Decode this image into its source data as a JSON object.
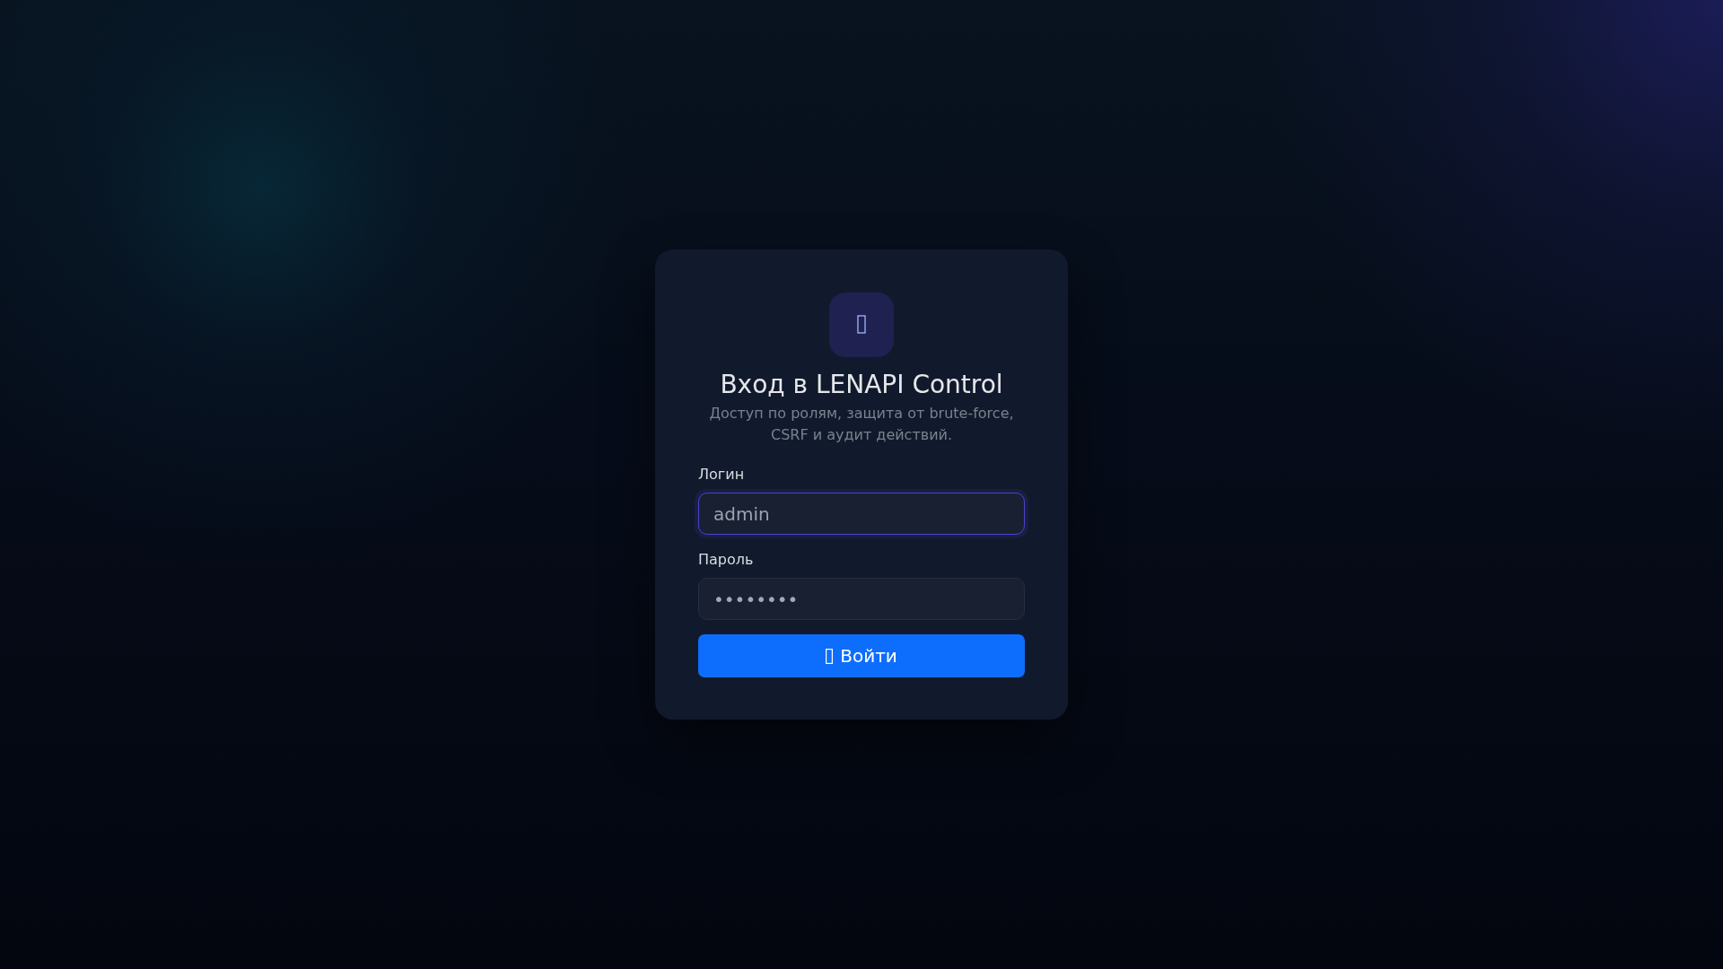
{
  "card": {
    "title": "Вход в LENAPI Control",
    "subtitle": "Доступ по ролям, защита от brute-force, CSRF и аудит действий."
  },
  "fields": [
    {
      "kind": "text",
      "label": "Логин",
      "value": "admin",
      "focused": true
    },
    {
      "kind": "password",
      "label": "Пароль",
      "value": "••••••••",
      "focused": false
    }
  ],
  "submit_button": {
    "label": "Войти"
  }
}
